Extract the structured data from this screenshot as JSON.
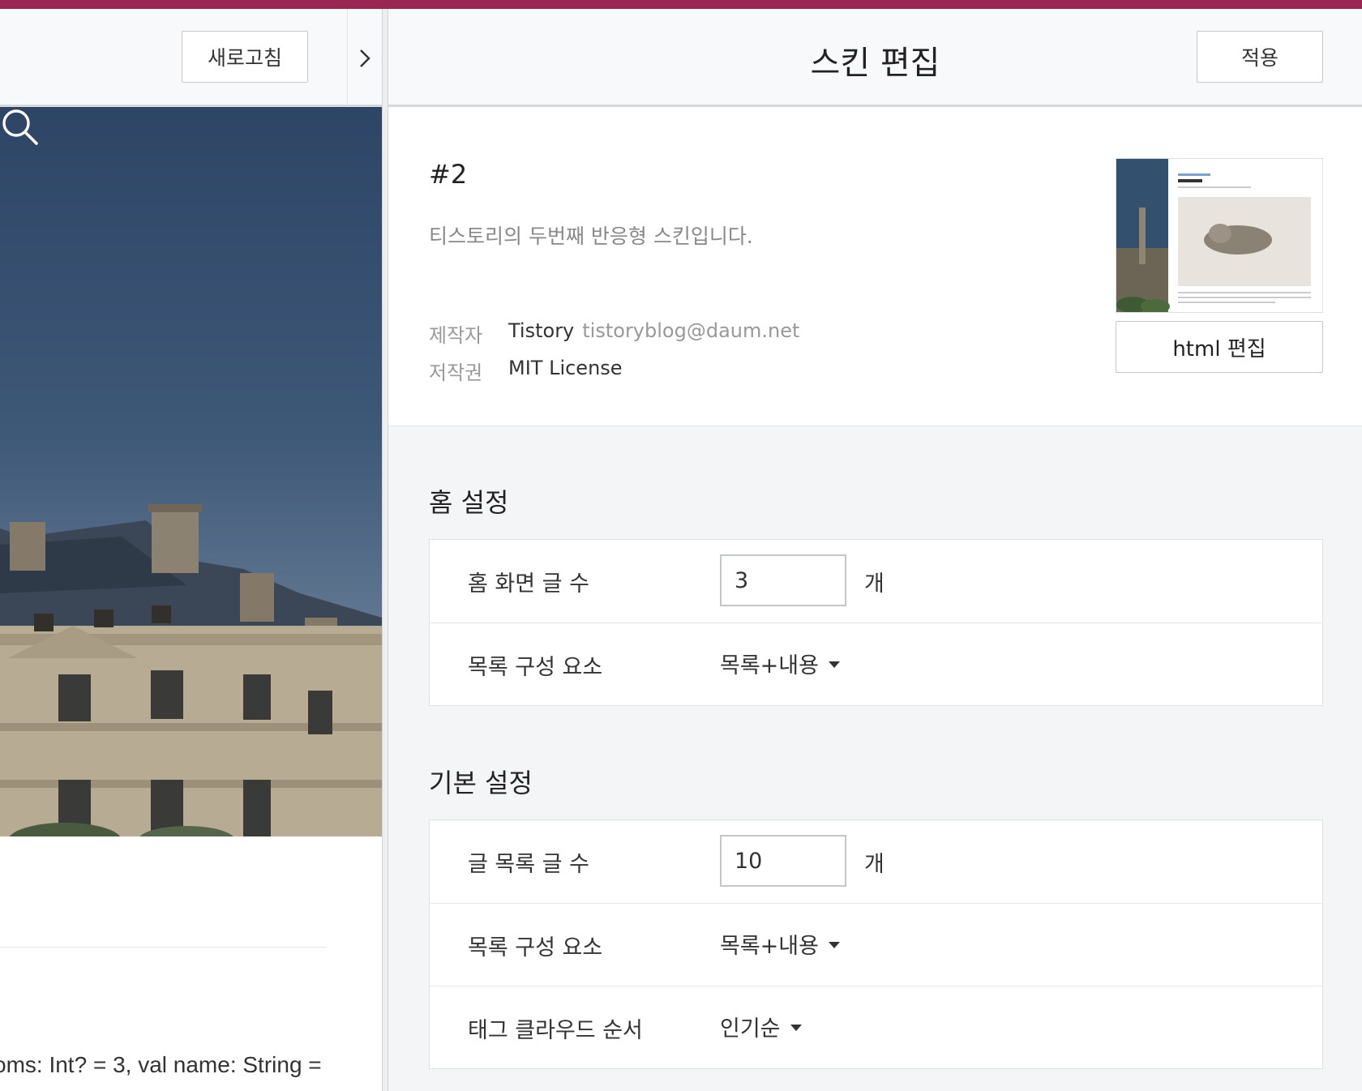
{
  "colors": {
    "accent_bar": "#9a2550",
    "sky": "#2e4566"
  },
  "preview": {
    "refresh_label": "새로고침",
    "collapse_icon": "chevron-right-icon",
    "search_icon": "search-icon",
    "code_snippet": "oms: Int? = 3, val name: String ="
  },
  "editor": {
    "title": "스킨 편집",
    "apply_label": "적용",
    "skin": {
      "name": "#2",
      "description": "티스토리의 두번째 반응형 스킨입니다.",
      "author_label": "제작자",
      "author_name": "Tistory",
      "author_email": "tistoryblog@daum.net",
      "license_label": "저작권",
      "license_value": "MIT License",
      "html_edit_label": "html 편집"
    },
    "home_settings": {
      "title": "홈 설정",
      "post_count_label": "홈 화면 글 수",
      "post_count_value": "3",
      "post_count_unit": "개",
      "list_component_label": "목록 구성 요소",
      "list_component_value": "목록+내용"
    },
    "basic_settings": {
      "title": "기본 설정",
      "list_count_label": "글 목록 글 수",
      "list_count_value": "10",
      "list_count_unit": "개",
      "list_component_label": "목록 구성 요소",
      "list_component_value": "목록+내용",
      "tag_cloud_label": "태그 클라우드 순서",
      "tag_cloud_value": "인기순"
    }
  }
}
